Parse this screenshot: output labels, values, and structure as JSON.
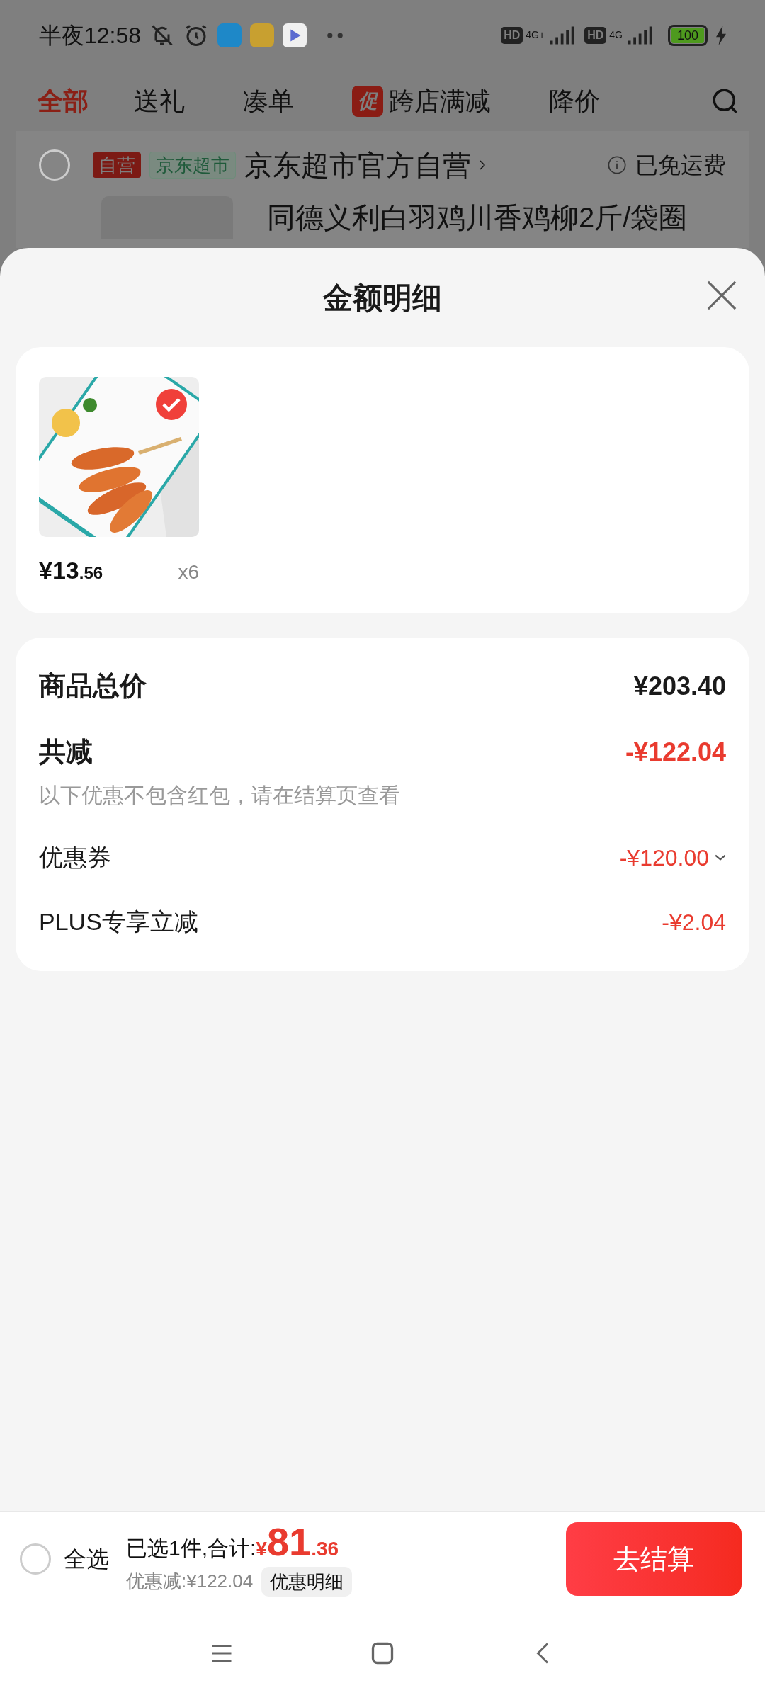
{
  "status_bar": {
    "time": "半夜12:58",
    "networks": [
      {
        "hd": "HD",
        "type": "4G+"
      },
      {
        "hd": "HD",
        "type": "4G"
      }
    ],
    "battery": "100"
  },
  "tabs": [
    {
      "label": "全部",
      "selected": true
    },
    {
      "label": "送礼",
      "selected": false
    },
    {
      "label": "凑单",
      "selected": false
    },
    {
      "label": "跨店满减",
      "selected": false,
      "badge": "促"
    },
    {
      "label": "降价",
      "selected": false
    }
  ],
  "store": {
    "checked": false,
    "tags": [
      {
        "kind": "self",
        "text": "自营"
      },
      {
        "kind": "channel",
        "text": "京东超市"
      }
    ],
    "name": "京东超市官方自营",
    "shipping": "已免运费",
    "product_title": "同德义利白羽鸡川香鸡柳2斤/袋圈"
  },
  "sheet": {
    "title": "金额明细",
    "items": [
      {
        "price_main": "¥13",
        "price_decimal": ".56",
        "quantity": "x6",
        "selected": true
      }
    ],
    "summary": [
      {
        "kind": "total",
        "label": "商品总价",
        "value": "¥203.40"
      },
      {
        "kind": "discount_total",
        "label": "共减",
        "value": "-¥122.04",
        "note": "以下优惠不包含红包，请在结算页查看"
      },
      {
        "kind": "discount",
        "label": "优惠券",
        "value": "-¥120.00",
        "expandable": true
      },
      {
        "kind": "discount",
        "label": "PLUS专享立减",
        "value": "-¥2.04",
        "expandable": false
      }
    ]
  },
  "bottom_bar": {
    "select_all": {
      "label": "全选",
      "checked": false
    },
    "summary": "已选1件,合计:",
    "currency": "¥",
    "amount_main": "81",
    "amount_decimal": ".36",
    "discount": "优惠减:¥122.04",
    "detail_button": "优惠明细",
    "checkout": "去结算"
  }
}
